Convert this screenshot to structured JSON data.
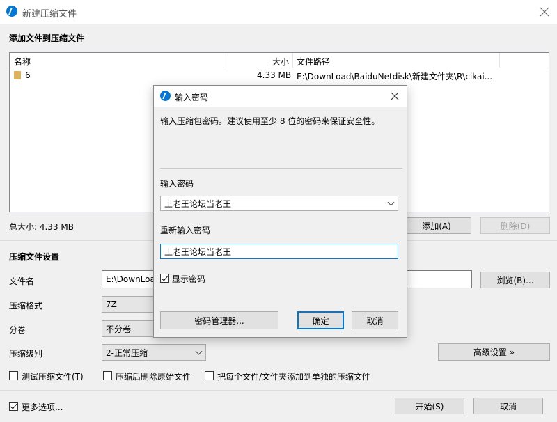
{
  "window": {
    "title": "新建压缩文件"
  },
  "section_add": {
    "header": "添加文件到压缩文件"
  },
  "file_list": {
    "columns": [
      "名称",
      "大小",
      "文件路径"
    ],
    "rows": [
      {
        "name": "6",
        "size": "4.33 MB",
        "path": "E:\\DownLoad\\BaiduNetdisk\\新建文件夹\\R\\cikai..."
      }
    ]
  },
  "total_size": "总大小: 4.33 MB",
  "buttons": {
    "add": "添加(A)",
    "delete": "删除(D)",
    "browse": "浏览(B)...",
    "advanced": "高级设置 »",
    "start": "开始(S)",
    "cancel": "取消"
  },
  "settings": {
    "header": "压缩文件设置",
    "filename_label": "文件名",
    "filename_value": "E:\\DownLoa",
    "format_label": "压缩格式",
    "format_value": "7Z",
    "split_label": "分卷",
    "split_value": "不分卷",
    "level_label": "压缩级别",
    "level_value": "2-正常压缩"
  },
  "options": {
    "test": {
      "label": "测试压缩文件(T)",
      "checked": false
    },
    "delete_after": {
      "label": "压缩后删除原始文件",
      "checked": false
    },
    "each_separate": {
      "label": "把每个文件/文件夹添加到单独的压缩文件",
      "checked": false
    },
    "more": {
      "label": "更多选项...",
      "checked": true
    }
  },
  "dialog": {
    "title": "输入密码",
    "hint": "输入压缩包密码。建议使用至少 8 位的密码来保证安全性。",
    "password_label": "输入密码",
    "password_value": "上老王论坛当老王",
    "repeat_label": "重新输入密码",
    "repeat_value": "上老王论坛当老王",
    "show_password": {
      "label": "显示密码",
      "checked": true
    },
    "buttons": {
      "manager": "密码管理器...",
      "ok": "确定",
      "cancel": "取消"
    }
  },
  "colors": {
    "accent": "#0078d7",
    "background": "#f0f0f0",
    "folder": "#dcb35c"
  },
  "icons": {
    "app": "app-logo-icon",
    "close": "close-icon",
    "folder": "folder-icon",
    "dropdown": "chevron-down-icon"
  }
}
